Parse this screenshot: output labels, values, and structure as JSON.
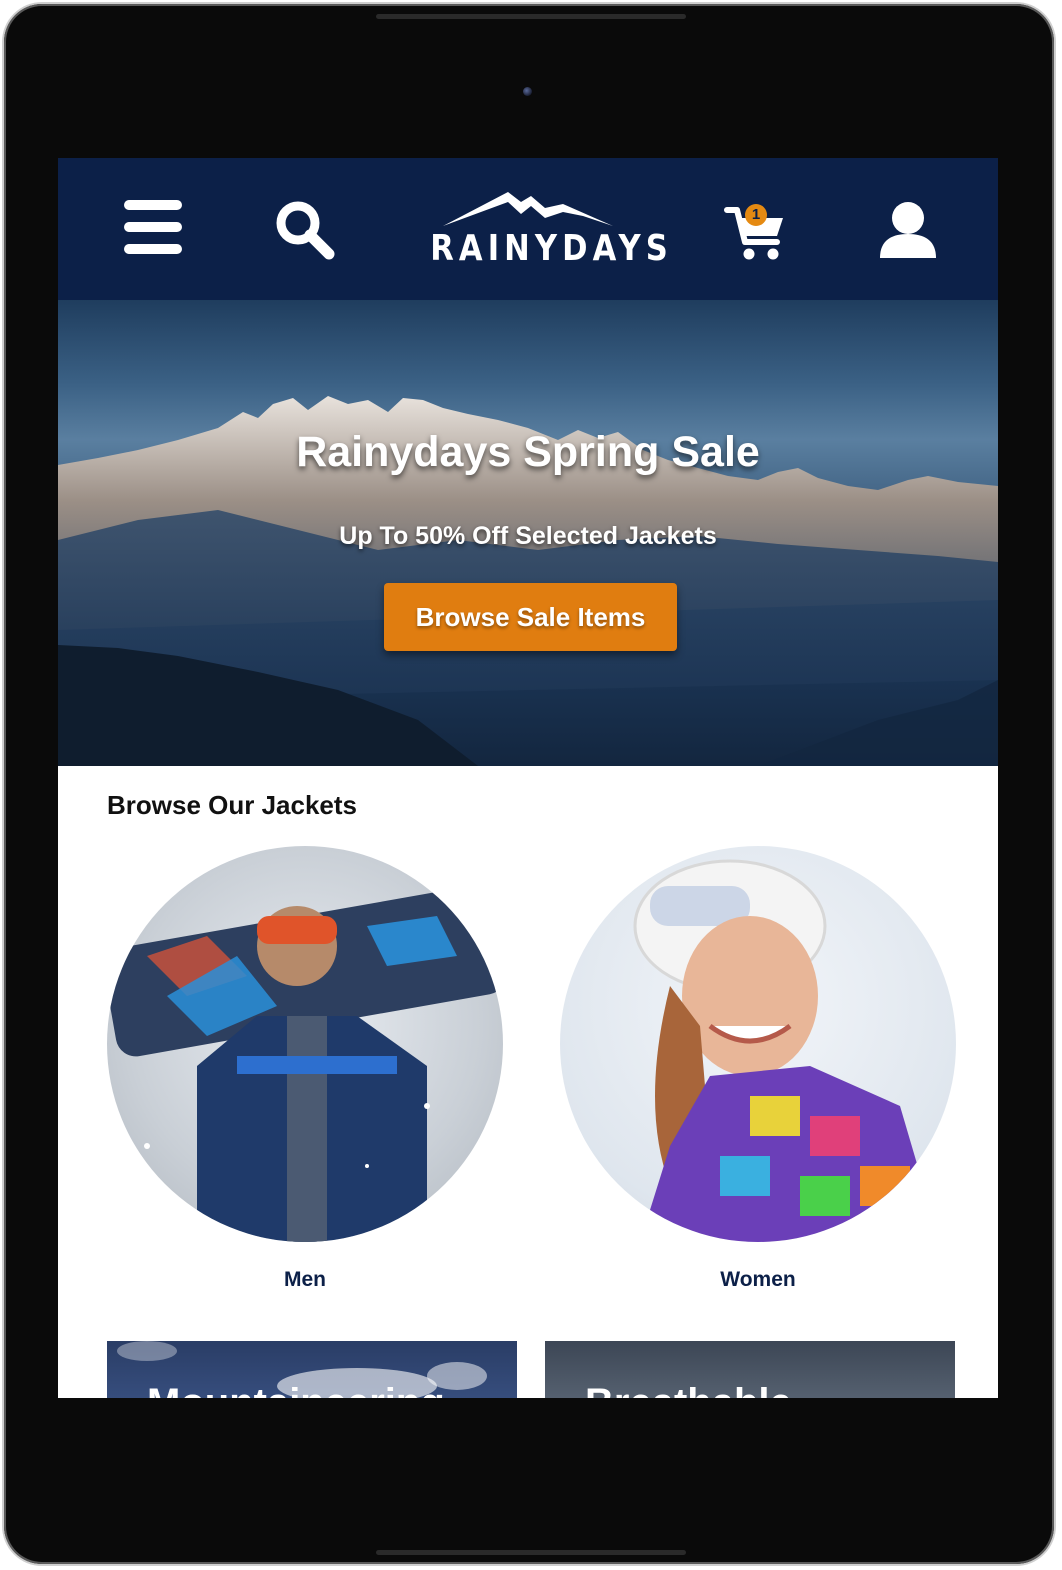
{
  "header": {
    "brand": "RAINYDAYS",
    "cart_count": "1",
    "icons": [
      "menu-icon",
      "search-icon",
      "cart-icon",
      "user-icon"
    ]
  },
  "hero": {
    "title": "Rainydays Spring Sale",
    "subtitle": "Up To 50% Off Selected Jackets",
    "cta_label": "Browse Sale Items"
  },
  "browse": {
    "title": "Browse Our Jackets",
    "categories": [
      {
        "label": "Men"
      },
      {
        "label": "Women"
      }
    ],
    "cards": [
      {
        "title": "Mountaineering"
      },
      {
        "title": "Breathable"
      }
    ]
  },
  "colors": {
    "nav_bg": "#0c2048",
    "accent": "#e07d10",
    "link": "#0c2048"
  }
}
